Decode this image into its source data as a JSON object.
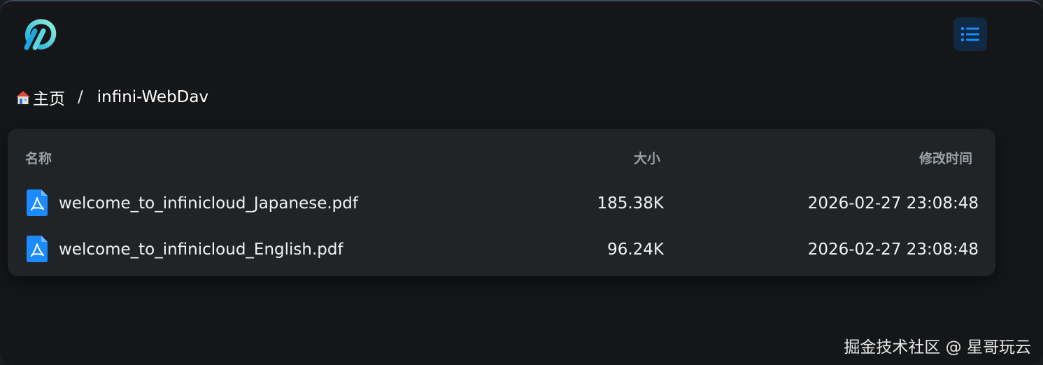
{
  "header": {
    "logo_icon": "infinicloud-logo-icon",
    "menu_icon": "list-icon",
    "accent_color": "#1a8cff"
  },
  "breadcrumb": {
    "home_icon": "house-icon",
    "home_label": "主页",
    "separator": "/",
    "current": "infini-WebDav"
  },
  "table": {
    "columns": {
      "name": "名称",
      "size": "大小",
      "modified": "修改时间"
    },
    "rows": [
      {
        "icon": "pdf-file-icon",
        "name": "welcome_to_infinicloud_Japanese.pdf",
        "size": "185.38K",
        "modified": "2026-02-27 23:08:48"
      },
      {
        "icon": "pdf-file-icon",
        "name": "welcome_to_infinicloud_English.pdf",
        "size": "96.24K",
        "modified": "2026-02-27 23:08:48"
      }
    ]
  },
  "watermark": "掘金技术社区 @ 星哥玩云"
}
